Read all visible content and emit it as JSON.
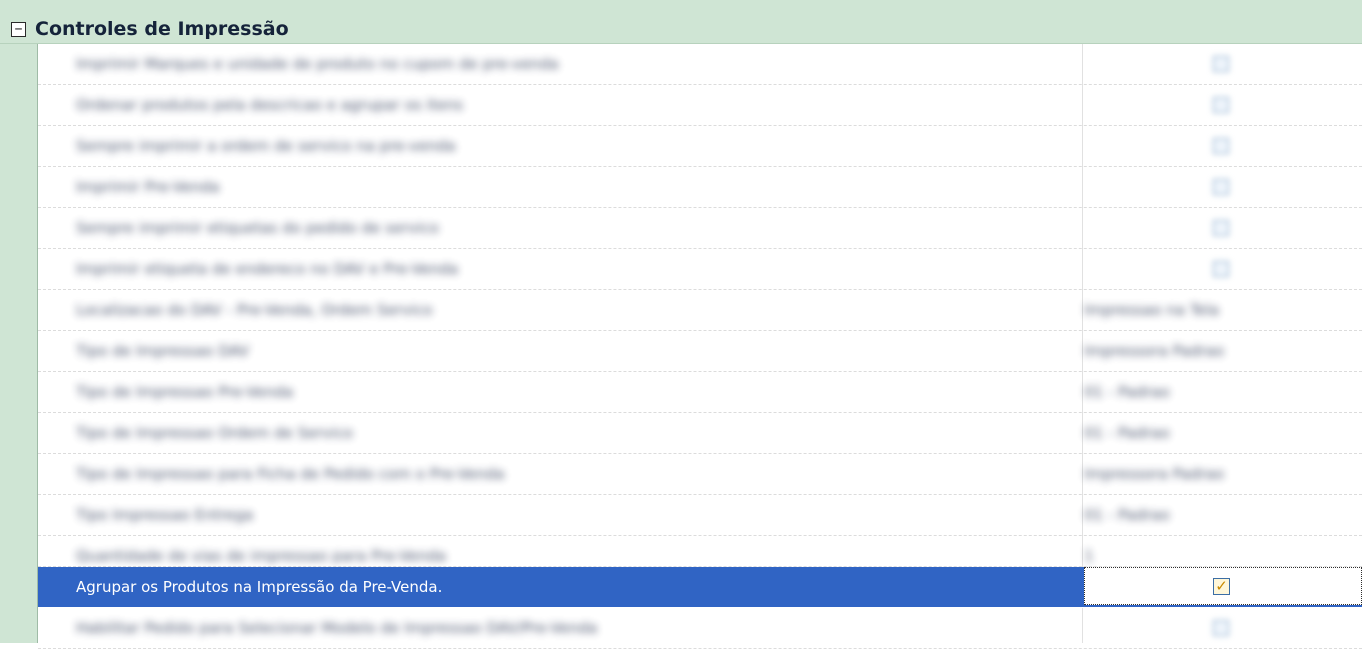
{
  "section": {
    "toggle_symbol": "−",
    "title": "Controles de Impressão"
  },
  "rows": [
    {
      "name": "Imprimir Marques e unidade de produto no cupom de pre-venda",
      "value": "",
      "has_check": true,
      "check_icon": "checkbox-icon"
    },
    {
      "name": "Ordenar produtos pela descricao e agrupar os itens",
      "value": "",
      "has_check": true,
      "check_icon": "checkbox-icon"
    },
    {
      "name": "Sempre imprimir a ordem de servico na pre-venda",
      "value": "",
      "has_check": true,
      "check_icon": "checkbox-icon"
    },
    {
      "name": "Imprimir Pre-Venda",
      "value": "",
      "has_check": true,
      "check_icon": "checkbox-icon"
    },
    {
      "name": "Sempre imprimir etiquetas do pedido de servico",
      "value": "",
      "has_check": true,
      "check_icon": "checkbox-icon"
    },
    {
      "name": "Imprimir etiqueta de endereco no DAV e Pre-Venda",
      "value": "",
      "has_check": true,
      "check_icon": "checkbox-icon"
    },
    {
      "name": "Localizacao do DAV - Pre-Venda, Ordem Servico",
      "value": "Impressao na Tela",
      "has_check": false
    },
    {
      "name": "Tipo de Impressao DAV",
      "value": "Impressora Padrao",
      "has_check": false
    },
    {
      "name": "Tipo de Impressao Pre-Venda",
      "value": "01 - Padrao",
      "has_check": false
    },
    {
      "name": "Tipo de Impressao Ordem de Servico",
      "value": "01 - Padrao",
      "has_check": false
    },
    {
      "name": "Tipo de Impressao para Ficha de Pedido com o Pre-Venda",
      "value": "Impressora Padrao",
      "has_check": false
    },
    {
      "name": "Tipo Impressao Entrega",
      "value": "01 - Padrao",
      "has_check": false
    },
    {
      "name": "Quantidade de vias de impressao para Pre-Venda",
      "value": "1",
      "has_check": false
    },
    {
      "name": "Agrupar os Produtos na Impressão da Pre-Venda.",
      "value": "",
      "has_check": true,
      "checked": true,
      "selected": true,
      "check_icon": "checkbox-checked-icon",
      "check_mark": "✓"
    },
    {
      "name": "Habilitar Pedido para Selecionar Modelo de Impressao DAV/Pre-Venda",
      "value": "",
      "has_check": true,
      "check_icon": "checkbox-icon"
    }
  ]
}
